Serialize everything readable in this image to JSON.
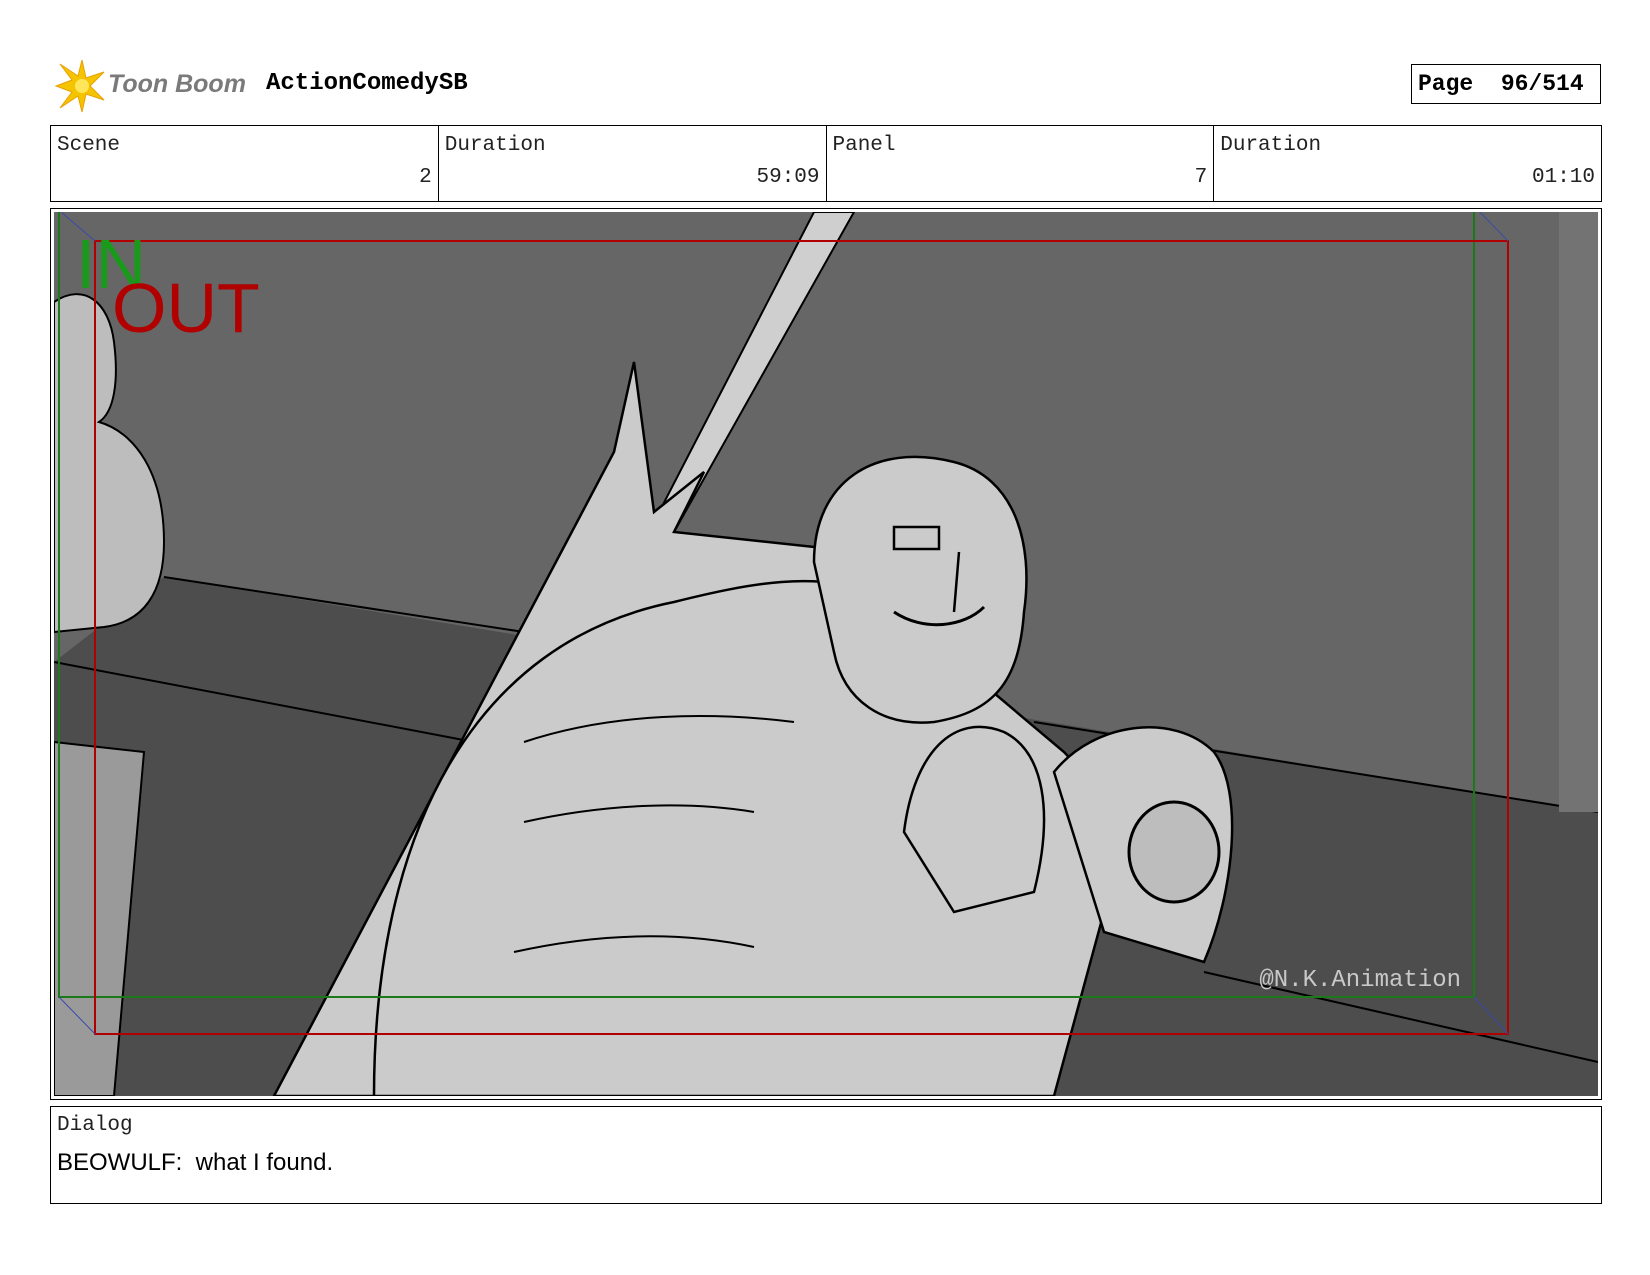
{
  "header": {
    "logo_text": "Toon Boom",
    "project": "ActionComedySB",
    "page_label": "Page",
    "page_value": "96/514"
  },
  "info": [
    {
      "label": "Scene",
      "value": "2"
    },
    {
      "label": "Duration",
      "value": "59:09"
    },
    {
      "label": "Panel",
      "value": "7"
    },
    {
      "label": "Duration",
      "value": "01:10"
    }
  ],
  "panel": {
    "in_label": "IN",
    "out_label": "OUT",
    "watermark": "@N.K.Animation",
    "in_color": "#1a8a1a",
    "out_color": "#b00000"
  },
  "dialog": {
    "label": "Dialog",
    "text": "BEOWULF:  what I found."
  }
}
